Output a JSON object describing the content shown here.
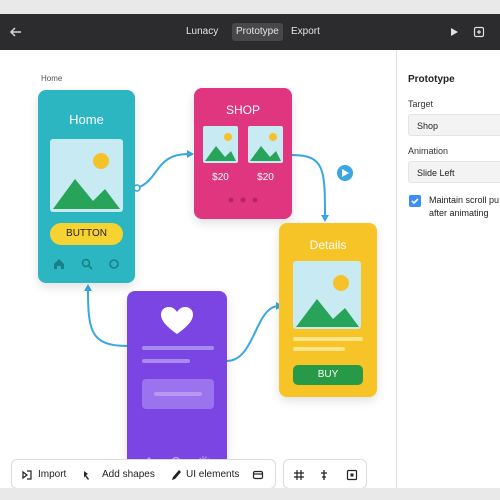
{
  "titlebar": {
    "tabs": [
      {
        "label": "Lunacy",
        "active": false
      },
      {
        "label": "Prototype",
        "active": true
      },
      {
        "label": "Export",
        "active": false
      }
    ]
  },
  "canvas": {
    "frame_label": "Home",
    "home_card": {
      "title": "Home",
      "button": "BUTTON",
      "color": "#2bb6c1"
    },
    "shop_card": {
      "title": "SHOP",
      "prices": [
        "$20",
        "$20"
      ],
      "color": "#e0357f"
    },
    "details_card": {
      "title": "Details",
      "button": "BUY",
      "color": "#f7c427"
    },
    "profile_card": {
      "color": "#7b45e3"
    },
    "accent_color": "#3aa7e2"
  },
  "panel": {
    "title": "Prototype",
    "target_label": "Target",
    "target_value": "Shop",
    "animation_label": "Animation",
    "animation_value": "Slide Left",
    "scroll_line1": "Maintain scroll pu",
    "scroll_line2": "after animating",
    "scroll_checked": true
  },
  "toolbar": {
    "import": "Import",
    "add_shapes": "Add shapes",
    "ui_elements": "UI elements"
  }
}
